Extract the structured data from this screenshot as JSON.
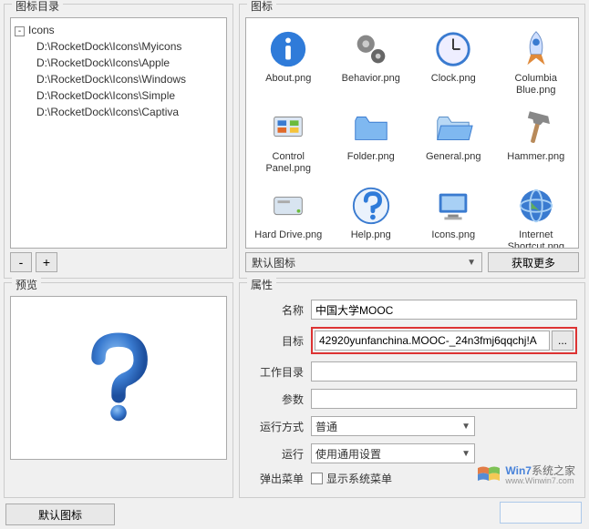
{
  "left": {
    "dir_group_label": "图标目录",
    "tree_root": "Icons",
    "tree_children": [
      "D:\\RocketDock\\Icons\\Myicons",
      "D:\\RocketDock\\Icons\\Apple",
      "D:\\RocketDock\\Icons\\Windows",
      "D:\\RocketDock\\Icons\\Simple",
      "D:\\RocketDock\\Icons\\Captiva"
    ],
    "minus": "-",
    "plus": "+",
    "preview_group_label": "预览",
    "default_icon_btn": "默认图标"
  },
  "right": {
    "icons_group_label": "图标",
    "icons": [
      {
        "name": "About.png",
        "kind": "info"
      },
      {
        "name": "Behavior.png",
        "kind": "gears"
      },
      {
        "name": "Clock.png",
        "kind": "clock"
      },
      {
        "name": "Columbia Blue.png",
        "kind": "rocket"
      },
      {
        "name": "Control Panel.png",
        "kind": "panel"
      },
      {
        "name": "Folder.png",
        "kind": "folder"
      },
      {
        "name": "General.png",
        "kind": "folder2"
      },
      {
        "name": "Hammer.png",
        "kind": "hammer"
      },
      {
        "name": "Hard Drive.png",
        "kind": "drive"
      },
      {
        "name": "Help.png",
        "kind": "help"
      },
      {
        "name": "Icons.png",
        "kind": "monitor"
      },
      {
        "name": "Internet Shortcut.png",
        "kind": "globe"
      },
      {
        "name": "",
        "kind": "diskb"
      },
      {
        "name": "",
        "kind": "folder"
      },
      {
        "name": "",
        "kind": "folder2"
      },
      {
        "name": "",
        "kind": "globe"
      }
    ],
    "combo_default": "默认图标",
    "get_more_btn": "获取更多",
    "props_group_label": "属性",
    "labels": {
      "name": "名称",
      "target": "目标",
      "workdir": "工作目录",
      "args": "参数",
      "runmode": "运行方式",
      "run": "运行",
      "popup": "弹出菜单"
    },
    "values": {
      "name": "中国大学MOOC",
      "target": "42920yunfanchina.MOOC-_24n3fmj6qqchj!A",
      "workdir": "",
      "args": "",
      "runmode": "普通",
      "run": "使用通用设置",
      "popup_checkbox_label": "显示系统菜单"
    },
    "browse_btn": "..."
  },
  "watermark": {
    "brand": "Win7",
    "suffix": "系统之家",
    "url": "www.Winwin7.com"
  }
}
